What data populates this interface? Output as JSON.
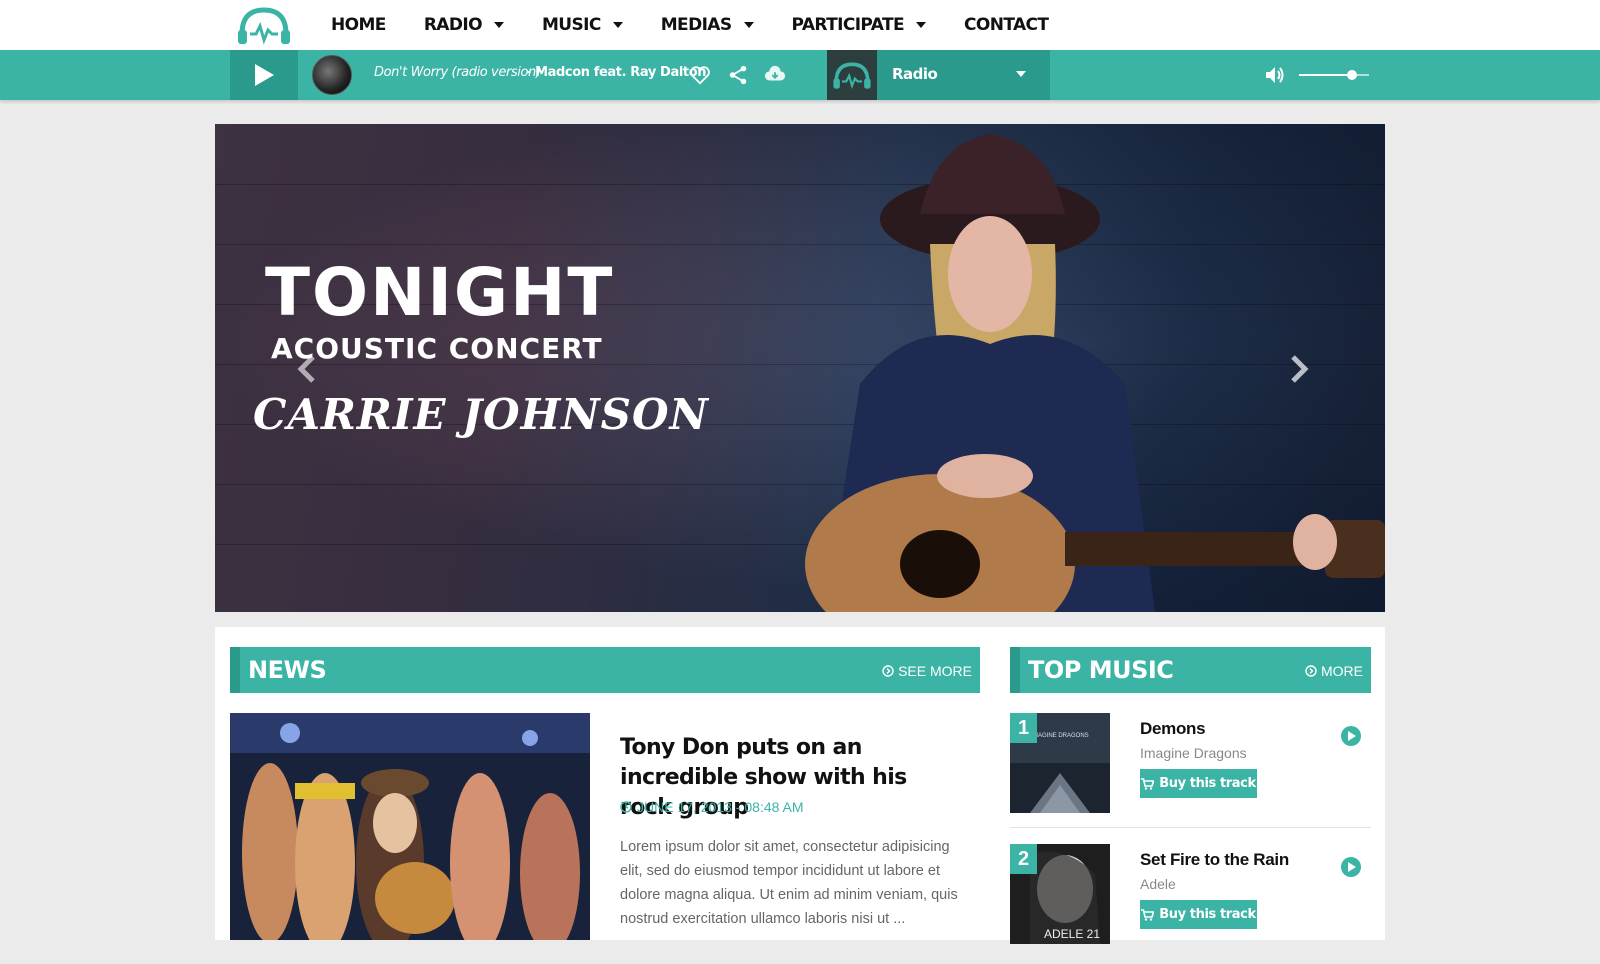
{
  "nav": {
    "items": [
      {
        "label": "HOME",
        "dropdown": false
      },
      {
        "label": "RADIO",
        "dropdown": true
      },
      {
        "label": "MUSIC",
        "dropdown": true
      },
      {
        "label": "MEDIAS",
        "dropdown": true
      },
      {
        "label": "PARTICIPATE",
        "dropdown": true
      },
      {
        "label": "CONTACT",
        "dropdown": false
      }
    ]
  },
  "player": {
    "track_title": "Don't Worry (radio version)",
    "track_artist": "- Madcon feat. Ray Dalton",
    "station": "Radio",
    "volume": 0.75,
    "icons": [
      "play-icon",
      "heart-icon",
      "share-icon",
      "cloud-download-icon",
      "volume-icon"
    ]
  },
  "hero": {
    "line1": "TONIGHT",
    "line2": "ACOUSTIC CONCERT",
    "line3": "CARRIE JOHNSON"
  },
  "news": {
    "heading": "NEWS",
    "more_label": "SEE MORE",
    "article": {
      "title": "Tony Don puts on an incredible show with his rock group",
      "date": "JUNE 17, 2013 - 08:48 AM",
      "body": "Lorem ipsum dolor sit amet, consectetur adipisicing elit, sed do eiusmod tempor incididunt ut labore et dolore magna aliqua. Ut enim ad minim veniam, quis nostrud exercitation ullamco laboris nisi ut ..."
    }
  },
  "top_music": {
    "heading": "TOP MUSIC",
    "more_label": "MORE",
    "items": [
      {
        "rank": "1",
        "title": "Demons",
        "artist": "Imagine Dragons",
        "buy_label": "Buy this track",
        "cover_text": "IMAGINE DRAGONS"
      },
      {
        "rank": "2",
        "title": "Set Fire to the Rain",
        "artist": "Adele",
        "buy_label": "Buy this track",
        "cover_text": "ADELE 21"
      }
    ]
  },
  "colors": {
    "accent": "#3cb4a5",
    "accent_dark": "#2a9a8c",
    "background": "#ebebeb"
  }
}
